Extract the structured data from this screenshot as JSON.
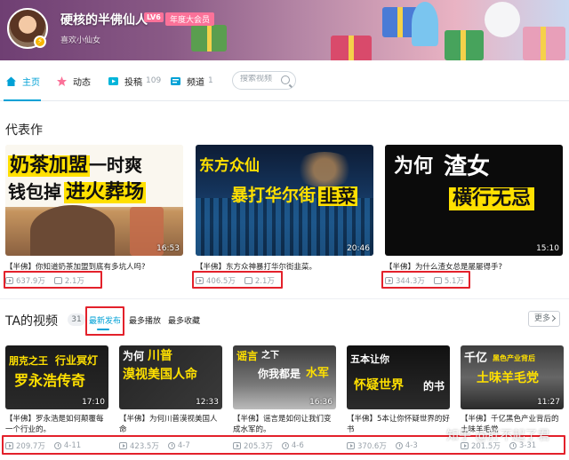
{
  "profile": {
    "username": "硬核的半佛仙人",
    "level": "LV6",
    "vip_label": "年度大会员",
    "signature": "喜欢小仙女"
  },
  "nav": {
    "home": "主页",
    "dynamic": "动态",
    "submissions": "投稿",
    "submissions_count": "109",
    "channels": "频道",
    "channels_count": "1",
    "search_placeholder": "搜索视频"
  },
  "featured": {
    "title": "代表作",
    "items": [
      {
        "thumb_line1": "奶茶加盟",
        "thumb_line1b": "一时爽",
        "thumb_line2a": "钱包掉",
        "thumb_line2b": "进火葬场",
        "duration": "16:53",
        "title": "【半佛】你知道奶茶加盟到底有多坑人吗?",
        "views": "637.9万",
        "danmaku": "2.1万"
      },
      {
        "thumb_line1": "东方众仙",
        "thumb_line2a": "暴打华尔街",
        "thumb_line2b": "韭菜",
        "duration": "20:46",
        "title": "【半佛】东方众神暴打华尔街韭菜。",
        "views": "406.5万",
        "danmaku": "2.1万"
      },
      {
        "thumb_line1a": "为何",
        "thumb_line1b": "渣女",
        "thumb_line2": "横行无忌",
        "duration": "15:10",
        "title": "【半佛】为什么渣女总是屡屡得手?",
        "views": "344.3万",
        "danmaku": "5.1万"
      }
    ]
  },
  "ta_videos": {
    "title": "TA的视频",
    "count": "31",
    "sort_latest": "最新发布",
    "sort_most_played": "最多播放",
    "sort_most_favorited": "最多收藏",
    "more": "更多",
    "items": [
      {
        "thumb_a": "朋克之王",
        "thumb_b": "行业冥灯",
        "thumb_c": "罗永浩传奇",
        "duration": "17:10",
        "title": "【半佛】罗永浩是如何颠覆每一个行业的。",
        "views": "209.7万",
        "date": "4-11"
      },
      {
        "thumb_a": "为何",
        "thumb_b": "川普",
        "thumb_c": "漠视美国人命",
        "duration": "12:33",
        "title": "【半佛】为何川普漠视美国人命",
        "views": "423.5万",
        "date": "4-7"
      },
      {
        "thumb_a": "谣言",
        "thumb_b": "之下",
        "thumb_c": "你我都是",
        "thumb_d": "水军",
        "duration": "16:36",
        "title": "【半佛】谣言是如何让我们变成水军的。",
        "views": "205.3万",
        "date": "4-6"
      },
      {
        "thumb_a": "五本让你",
        "thumb_b": "怀疑世界",
        "thumb_c": "的书",
        "duration": "",
        "title": "【半佛】5本让你怀疑世界的好书",
        "views": "370.6万",
        "date": "4-3"
      },
      {
        "thumb_a": "千亿",
        "thumb_b": "黑色产业背后",
        "thumb_c": "土味羊毛党",
        "duration": "11:27",
        "title": "【半佛】千亿黑色产业背后的土味羊毛党",
        "views": "201.5万",
        "date": "3-31"
      }
    ]
  },
  "watermark": "知乎 @肝不起了君",
  "colors": {
    "accent": "#00a1d6",
    "pink": "#fb7299",
    "highlight_box": "#e3212b",
    "thumb_yellow": "#ffe000"
  }
}
